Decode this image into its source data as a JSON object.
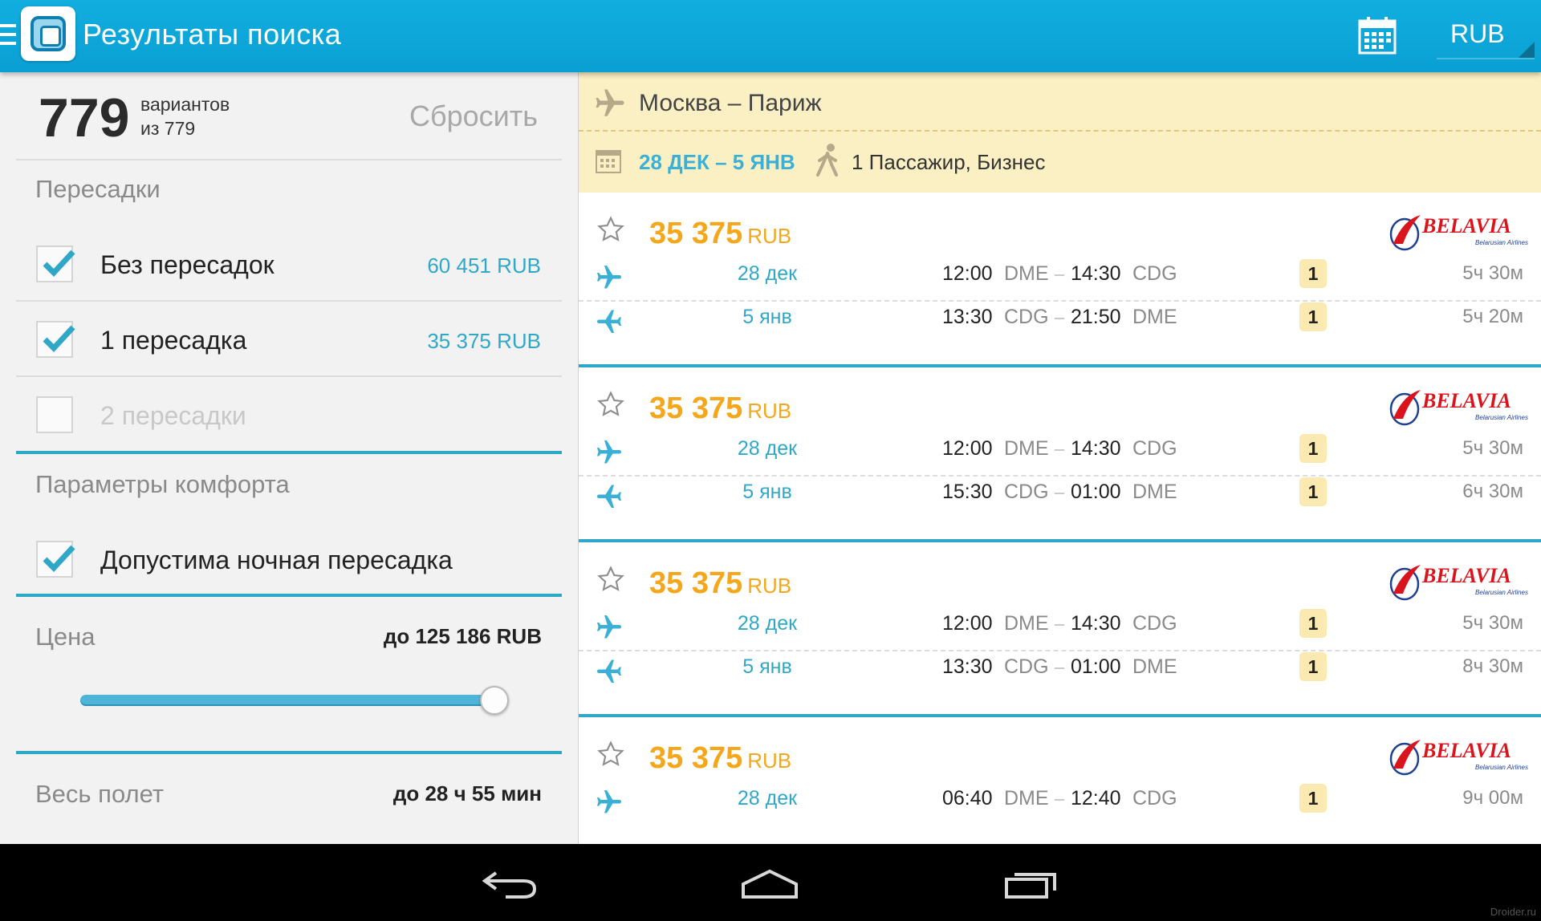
{
  "colors": {
    "accent": "#0a9fd3",
    "price": "#f4a71a",
    "link": "#2fa8c8",
    "badge": "#fbe9b2"
  },
  "actionbar": {
    "title": "Результаты поиска",
    "calendar_icon": "calendar-icon",
    "currency": "RUB"
  },
  "filters": {
    "count": "779",
    "count_label": "вариантов",
    "count_of": "из 779",
    "reset": "Сбросить",
    "transfers_title": "Пересадки",
    "transfers": [
      {
        "label": "Без пересадок",
        "price": "60 451 RUB",
        "checked": true
      },
      {
        "label": "1 пересадка",
        "price": "35 375 RUB",
        "checked": true
      },
      {
        "label": "2 пересадки",
        "price": "",
        "checked": false
      }
    ],
    "comfort_title": "Параметры комфорта",
    "night_transfer": {
      "label": "Допустима ночная пересадка",
      "checked": true
    },
    "price_title": "Цена",
    "price_value": "до 125 186 RUB",
    "price_slider_level": 1.0,
    "duration_title": "Весь полет",
    "duration_value": "до 28 ч 55 мин"
  },
  "route": {
    "name": "Москва – Париж",
    "dates": "28 ДЕК – 5 ЯНВ",
    "passengers": "1 Пассажир, Бизнес"
  },
  "tickets": [
    {
      "price": "35 375",
      "currency": "RUB",
      "airline": "BELAVIA",
      "airline_sub": "Belarusian Airlines",
      "legs": [
        {
          "date": "28 дек",
          "dep": "12:00",
          "from": "DME",
          "arr": "14:30",
          "to": "CDG",
          "stops": "1",
          "duration": "5ч 30м"
        },
        {
          "date": "5 янв",
          "dep": "13:30",
          "from": "CDG",
          "arr": "21:50",
          "to": "DME",
          "stops": "1",
          "duration": "5ч 20м"
        }
      ]
    },
    {
      "price": "35 375",
      "currency": "RUB",
      "airline": "BELAVIA",
      "airline_sub": "Belarusian Airlines",
      "legs": [
        {
          "date": "28 дек",
          "dep": "12:00",
          "from": "DME",
          "arr": "14:30",
          "to": "CDG",
          "stops": "1",
          "duration": "5ч 30м"
        },
        {
          "date": "5 янв",
          "dep": "15:30",
          "from": "CDG",
          "arr": "01:00",
          "to": "DME",
          "stops": "1",
          "duration": "6ч 30м"
        }
      ]
    },
    {
      "price": "35 375",
      "currency": "RUB",
      "airline": "BELAVIA",
      "airline_sub": "Belarusian Airlines",
      "legs": [
        {
          "date": "28 дек",
          "dep": "12:00",
          "from": "DME",
          "arr": "14:30",
          "to": "CDG",
          "stops": "1",
          "duration": "5ч 30м"
        },
        {
          "date": "5 янв",
          "dep": "13:30",
          "from": "CDG",
          "arr": "01:00",
          "to": "DME",
          "stops": "1",
          "duration": "8ч 30м"
        }
      ]
    },
    {
      "price": "35 375",
      "currency": "RUB",
      "airline": "BELAVIA",
      "airline_sub": "Belarusian Airlines",
      "legs": [
        {
          "date": "28 дек",
          "dep": "06:40",
          "from": "DME",
          "arr": "12:40",
          "to": "CDG",
          "stops": "1",
          "duration": "9ч 00м"
        }
      ]
    }
  ],
  "navbar": {
    "buttons": [
      "back-icon",
      "home-icon",
      "recent-apps-icon"
    ]
  },
  "watermark": "Droider.ru"
}
